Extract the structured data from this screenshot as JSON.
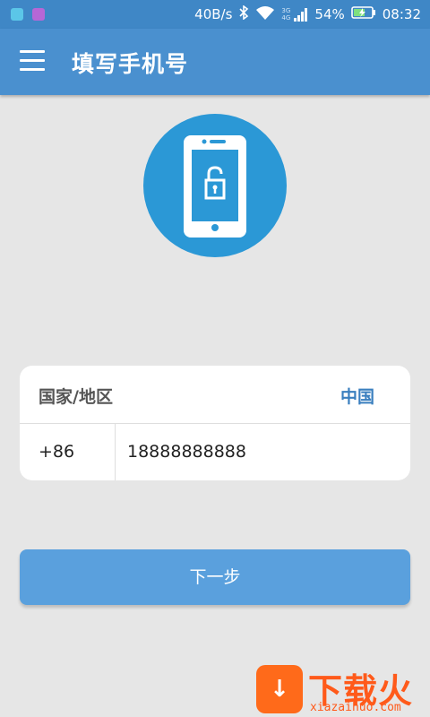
{
  "status_bar": {
    "net_speed": "40B/s",
    "network_badge": "3G 4G",
    "battery_percent": "54%",
    "time": "08:32",
    "notification_colors": [
      "#5bc6e8",
      "#b667d6"
    ]
  },
  "app_bar": {
    "title": "填写手机号",
    "menu_icon": "menu-icon"
  },
  "hero": {
    "icon": "phone-unlock-icon"
  },
  "form": {
    "country_label": "国家/地区",
    "country_value": "中国",
    "country_code": "+86",
    "phone_value": "18888888888"
  },
  "next_button": {
    "label": "下一步"
  },
  "watermark": {
    "brand": "下载火",
    "url": "xiazaihuo.com"
  },
  "colors": {
    "app_bar": "#4a90cf",
    "hero_circle": "#2b98d6",
    "button": "#5aa0dd",
    "accent_text": "#3a7fbf"
  }
}
